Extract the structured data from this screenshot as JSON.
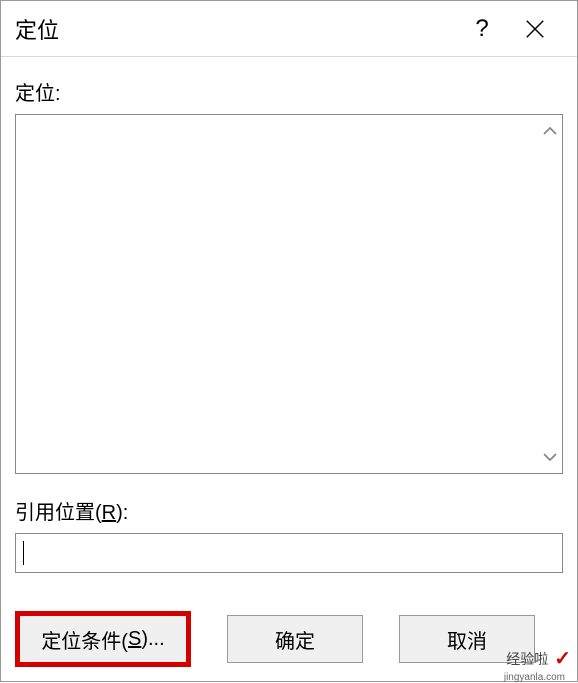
{
  "titlebar": {
    "title": "定位",
    "help": "?",
    "close": "×"
  },
  "content": {
    "goto_label": "定位:",
    "reference_label_prefix": "引用位置(",
    "reference_label_key": "R",
    "reference_label_suffix": "):",
    "reference_value": ""
  },
  "buttons": {
    "special_prefix": "定位条件(",
    "special_key": "S",
    "special_suffix": ")...",
    "ok": "确定",
    "cancel": "取消"
  },
  "watermark": {
    "text": "经验啦",
    "sub": "jingyanla.com",
    "check": "✓"
  }
}
